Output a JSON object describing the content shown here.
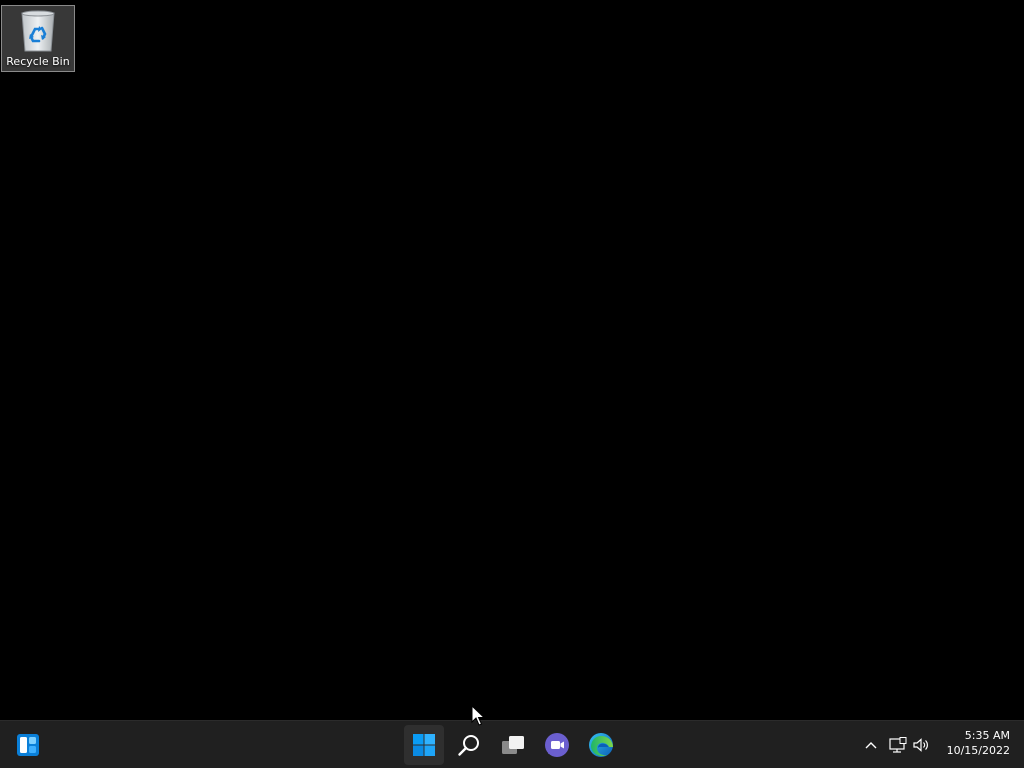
{
  "desktop": {
    "icons": [
      {
        "label": "Recycle Bin",
        "icon": "recycle-bin-icon"
      }
    ]
  },
  "taskbar": {
    "widgets": {
      "icon": "widgets-icon"
    },
    "apps": [
      {
        "name": "Start",
        "icon": "windows-start-icon",
        "active": true
      },
      {
        "name": "Search",
        "icon": "search-icon"
      },
      {
        "name": "Task View",
        "icon": "task-view-icon"
      },
      {
        "name": "Chat",
        "icon": "chat-icon"
      },
      {
        "name": "Microsoft Edge",
        "icon": "edge-icon"
      }
    ],
    "tray": {
      "overflow_icon": "chevron-up-icon",
      "network_icon": "network-icon",
      "volume_icon": "volume-icon",
      "time": "5:35 AM",
      "date": "10/15/2022"
    }
  },
  "colors": {
    "desktop_bg": "#000000",
    "taskbar_bg": "#202020",
    "start_blue": "#0a9cf5",
    "chat_purple": "#6b5fcf"
  }
}
